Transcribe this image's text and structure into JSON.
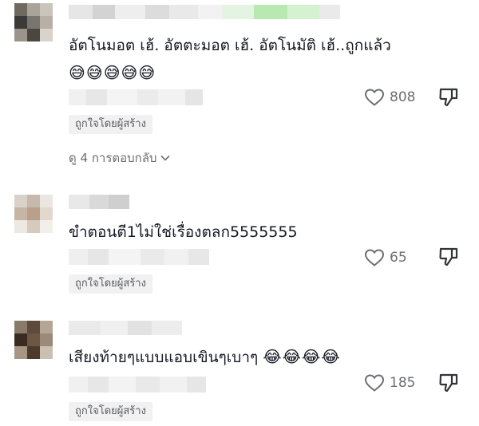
{
  "comments": [
    {
      "text": "อัตโนมอต เฮ้. อัตตะมอต เฮ้. อัตโนมัติ เฮ้..ถูกแล้ว",
      "emojis": "😅😅😅😅😅",
      "likes": "808",
      "creator_tag": "ถูกใจโดยผู้สร้าง",
      "replies_label": "ดู 4 การตอบกลับ"
    },
    {
      "text": "ขำตอนตี1ไม่ใช่เรื่องตลก5555555",
      "emojis": "",
      "likes": "65",
      "creator_tag": "ถูกใจโดยผู้สร้าง"
    },
    {
      "text": "เสียงท้ายๆแบบแอบเขินๆเบาๆ",
      "emojis": "😂😂😂😂",
      "likes": "185",
      "creator_tag": "ถูกใจโดยผู้สร้าง"
    }
  ],
  "icons": {
    "like": "heart-icon",
    "dislike": "thumbs-down-icon",
    "expand": "chevron-down-icon"
  },
  "colors": {
    "text": "#161823",
    "secondary": "#6d6e74",
    "tag_bg": "#f1f1f2"
  }
}
